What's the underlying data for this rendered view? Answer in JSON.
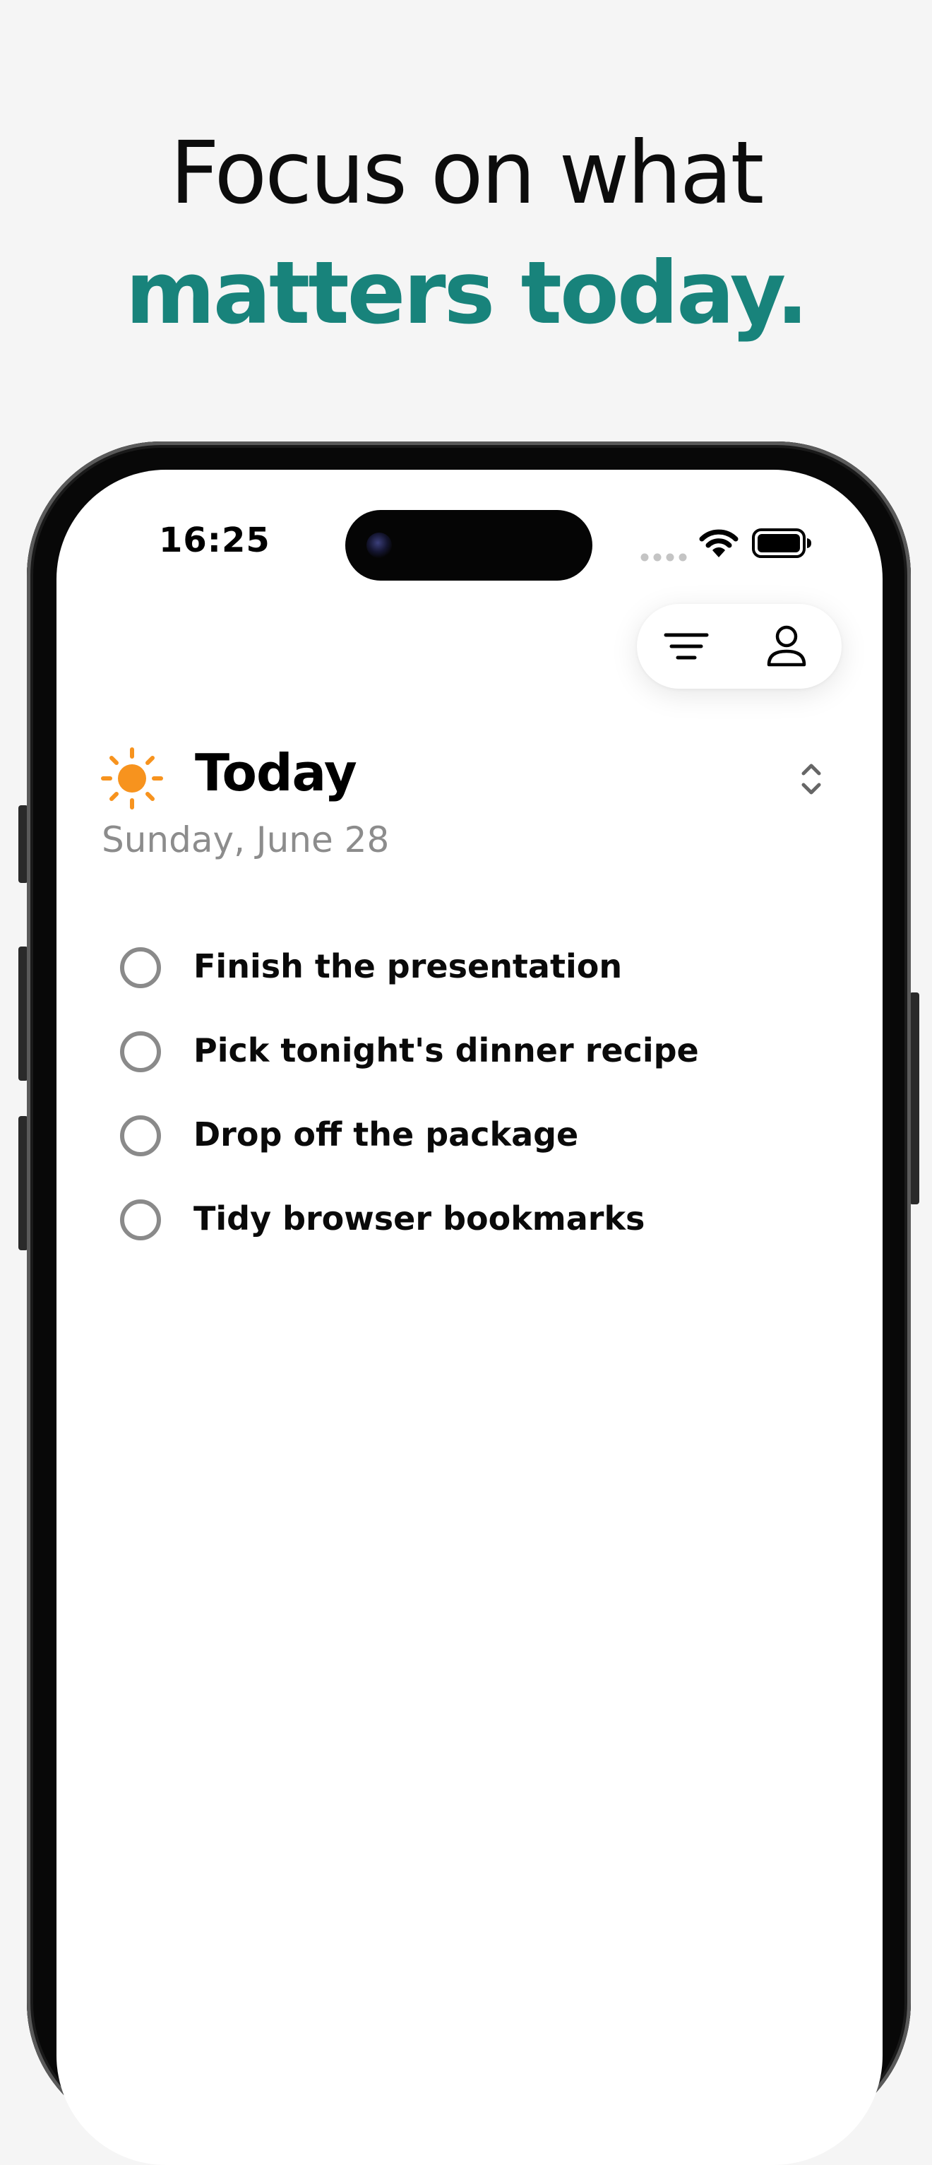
{
  "headline": {
    "line1": "Focus on what",
    "line2": "matters today."
  },
  "status_bar": {
    "time": "16:25",
    "icons": [
      "signal-icon",
      "wifi-icon",
      "battery-icon"
    ]
  },
  "toolbar": {
    "icons": [
      "filter-icon",
      "profile-icon"
    ]
  },
  "header": {
    "icon": "sun-icon",
    "title": "Today",
    "date": "Sunday, June 28",
    "sort_icon": "chevron-up-down-icon"
  },
  "tasks": [
    {
      "label": "Finish the presentation",
      "done": false
    },
    {
      "label": "Pick tonight's dinner recipe",
      "done": false
    },
    {
      "label": "Drop off the package",
      "done": false
    },
    {
      "label": "Tidy browser bookmarks",
      "done": false
    }
  ],
  "colors": {
    "accent": "#18837b",
    "sun": "#f7931e",
    "background": "#f5f5f5",
    "checkbox": "#8a8a8a",
    "date_text": "#8c8c8c"
  }
}
